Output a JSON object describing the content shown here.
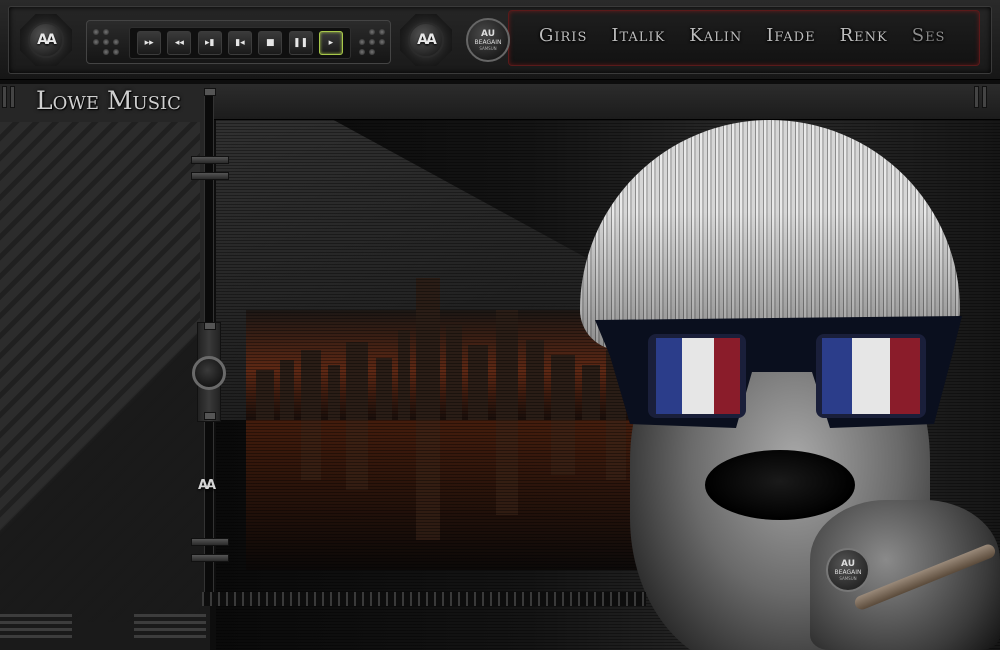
{
  "app": {
    "title": "Lowe Music"
  },
  "logos": {
    "left_mark": "AA",
    "right_mark": "AA",
    "slider_mark": "AA"
  },
  "badge": {
    "line1": "AU",
    "line2": "BEAGAIN",
    "line3": "SAMSUN"
  },
  "transport": {
    "buttons": [
      {
        "name": "fast-forward",
        "glyph": "▸▸"
      },
      {
        "name": "rewind",
        "glyph": "◂◂"
      },
      {
        "name": "next",
        "glyph": "▸▮"
      },
      {
        "name": "previous",
        "glyph": "▮◂"
      },
      {
        "name": "stop",
        "glyph": "■"
      },
      {
        "name": "pause",
        "glyph": "❚❚"
      },
      {
        "name": "play",
        "glyph": "▸",
        "active": true
      }
    ]
  },
  "menu": {
    "items": [
      "Giris",
      "Italik",
      "Kalin",
      "Ifade",
      "Renk",
      "Ses"
    ]
  },
  "volume": {
    "level": 0.56
  },
  "colors": {
    "accent_active": "#a8c84a",
    "menu_border": "#5a1a1a"
  }
}
